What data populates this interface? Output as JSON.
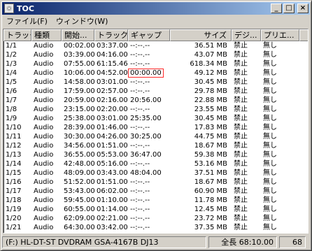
{
  "window": {
    "title": "TOC"
  },
  "titlebar_buttons": {
    "minimize": "_",
    "maximize": "□",
    "close": "×"
  },
  "menu": [
    {
      "label": "ファイル(F)"
    },
    {
      "label": "ウィンドウ(W)"
    }
  ],
  "columns": [
    "トラック",
    "種類",
    "開始...",
    "トラック...",
    "ギャップ",
    "サイズ",
    "デジ...",
    "プリエ..."
  ],
  "rows": [
    {
      "track": "1/1",
      "type": "Audio",
      "start": "00:02.00",
      "length": "03:37.00",
      "gap": "--:--.--",
      "size": "36.51 MB",
      "digital": "禁止",
      "pre": "無し"
    },
    {
      "track": "1/2",
      "type": "Audio",
      "start": "03:39.00",
      "length": "04:16.00",
      "gap": "--:--.--",
      "size": "43.07 MB",
      "digital": "禁止",
      "pre": "無し"
    },
    {
      "track": "1/3",
      "type": "Audio",
      "start": "07:55.00",
      "length": "61:15.46",
      "gap": "--:--.--",
      "size": "618.34 MB",
      "digital": "禁止",
      "pre": "無し"
    },
    {
      "track": "1/4",
      "type": "Audio",
      "start": "10:06.00",
      "length": "04:52.00",
      "gap": "00:00.00",
      "size": "49.12 MB",
      "digital": "禁止",
      "pre": "無し"
    },
    {
      "track": "1/5",
      "type": "Audio",
      "start": "14:58.00",
      "length": "03:01.00",
      "gap": "--:--.--",
      "size": "30.45 MB",
      "digital": "禁止",
      "pre": "無し"
    },
    {
      "track": "1/6",
      "type": "Audio",
      "start": "17:59.00",
      "length": "02:57.00",
      "gap": "--:--.--",
      "size": "29.78 MB",
      "digital": "禁止",
      "pre": "無し"
    },
    {
      "track": "1/7",
      "type": "Audio",
      "start": "20:59.00",
      "length": "02:16.00",
      "gap": "20:56.00",
      "size": "22.88 MB",
      "digital": "禁止",
      "pre": "無し"
    },
    {
      "track": "1/8",
      "type": "Audio",
      "start": "23:15.00",
      "length": "02:20.00",
      "gap": "--:--.--",
      "size": "23.55 MB",
      "digital": "禁止",
      "pre": "無し"
    },
    {
      "track": "1/9",
      "type": "Audio",
      "start": "25:38.00",
      "length": "03:01.00",
      "gap": "25:35.00",
      "size": "30.45 MB",
      "digital": "禁止",
      "pre": "無し"
    },
    {
      "track": "1/10",
      "type": "Audio",
      "start": "28:39.00",
      "length": "01:46.00",
      "gap": "--:--.--",
      "size": "17.83 MB",
      "digital": "禁止",
      "pre": "無し"
    },
    {
      "track": "1/11",
      "type": "Audio",
      "start": "30:30.00",
      "length": "04:26.00",
      "gap": "30:25.00",
      "size": "44.75 MB",
      "digital": "禁止",
      "pre": "無し"
    },
    {
      "track": "1/12",
      "type": "Audio",
      "start": "34:56.00",
      "length": "01:51.00",
      "gap": "--:--.--",
      "size": "18.67 MB",
      "digital": "禁止",
      "pre": "無し"
    },
    {
      "track": "1/13",
      "type": "Audio",
      "start": "36:55.00",
      "length": "05:53.00",
      "gap": "36:47.00",
      "size": "59.38 MB",
      "digital": "禁止",
      "pre": "無し"
    },
    {
      "track": "1/14",
      "type": "Audio",
      "start": "42:48.00",
      "length": "05:16.00",
      "gap": "--:--.--",
      "size": "53.16 MB",
      "digital": "禁止",
      "pre": "無し"
    },
    {
      "track": "1/15",
      "type": "Audio",
      "start": "48:09.00",
      "length": "03:43.00",
      "gap": "48:04.00",
      "size": "37.51 MB",
      "digital": "禁止",
      "pre": "無し"
    },
    {
      "track": "1/16",
      "type": "Audio",
      "start": "51:52.00",
      "length": "01:51.00",
      "gap": "--:--.--",
      "size": "18.67 MB",
      "digital": "禁止",
      "pre": "無し"
    },
    {
      "track": "1/17",
      "type": "Audio",
      "start": "53:43.00",
      "length": "06:02.00",
      "gap": "--:--.--",
      "size": "60.90 MB",
      "digital": "禁止",
      "pre": "無し"
    },
    {
      "track": "1/18",
      "type": "Audio",
      "start": "59:45.00",
      "length": "01:10.00",
      "gap": "--:--.--",
      "size": "11.78 MB",
      "digital": "禁止",
      "pre": "無し"
    },
    {
      "track": "1/19",
      "type": "Audio",
      "start": "60:55.00",
      "length": "01:14.00",
      "gap": "--:--.--",
      "size": "12.45 MB",
      "digital": "禁止",
      "pre": "無し"
    },
    {
      "track": "1/20",
      "type": "Audio",
      "start": "62:09.00",
      "length": "02:21.00",
      "gap": "--:--.--",
      "size": "23.72 MB",
      "digital": "禁止",
      "pre": "無し"
    },
    {
      "track": "1/21",
      "type": "Audio",
      "start": "64:30.00",
      "length": "03:42.00",
      "gap": "--:--.--",
      "size": "37.35 MB",
      "digital": "禁止",
      "pre": "無し"
    }
  ],
  "highlight": {
    "row_index": 3,
    "color": "#ff2a2a"
  },
  "status": {
    "drive": "(F:) HL-DT-ST DVDRAM GSA-4167B DJ13",
    "total": "全長 68:10.00",
    "count": "68"
  }
}
